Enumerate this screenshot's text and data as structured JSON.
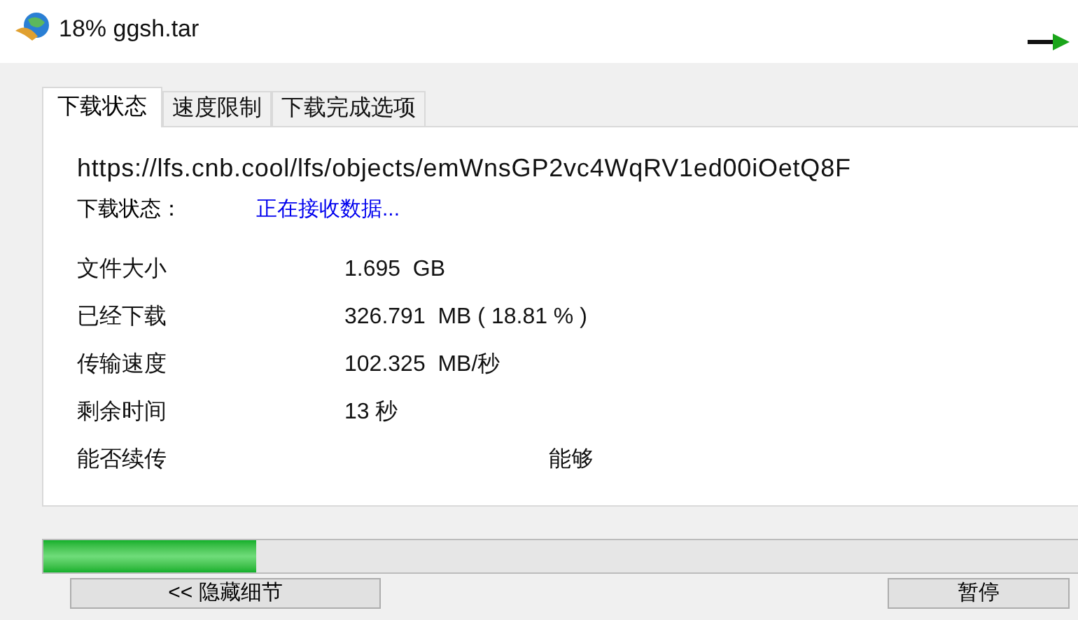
{
  "window": {
    "title": "18% ggsh.tar"
  },
  "tabs": [
    {
      "label": "下载状态",
      "selected": true
    },
    {
      "label": "速度限制",
      "selected": false
    },
    {
      "label": "下载完成选项",
      "selected": false
    }
  ],
  "url": "https://lfs.cnb.cool/lfs/objects/emWnsGP2vc4WqRV1ed00iOetQ8F",
  "status": {
    "label": "下载状态：",
    "value": "正在接收数据..."
  },
  "details": [
    {
      "label": "文件大小",
      "value": "1.695  GB"
    },
    {
      "label": "已经下载",
      "value": "326.791  MB ( 18.81 % )"
    },
    {
      "label": "传输速度",
      "value": "102.325  MB/秒"
    },
    {
      "label": "剩余时间",
      "value": "13 秒"
    },
    {
      "label": "能否续传",
      "value": "能够"
    }
  ],
  "progress": {
    "level": 0.2
  },
  "buttons": [
    "<< 隐藏细节",
    "暂停"
  ]
}
